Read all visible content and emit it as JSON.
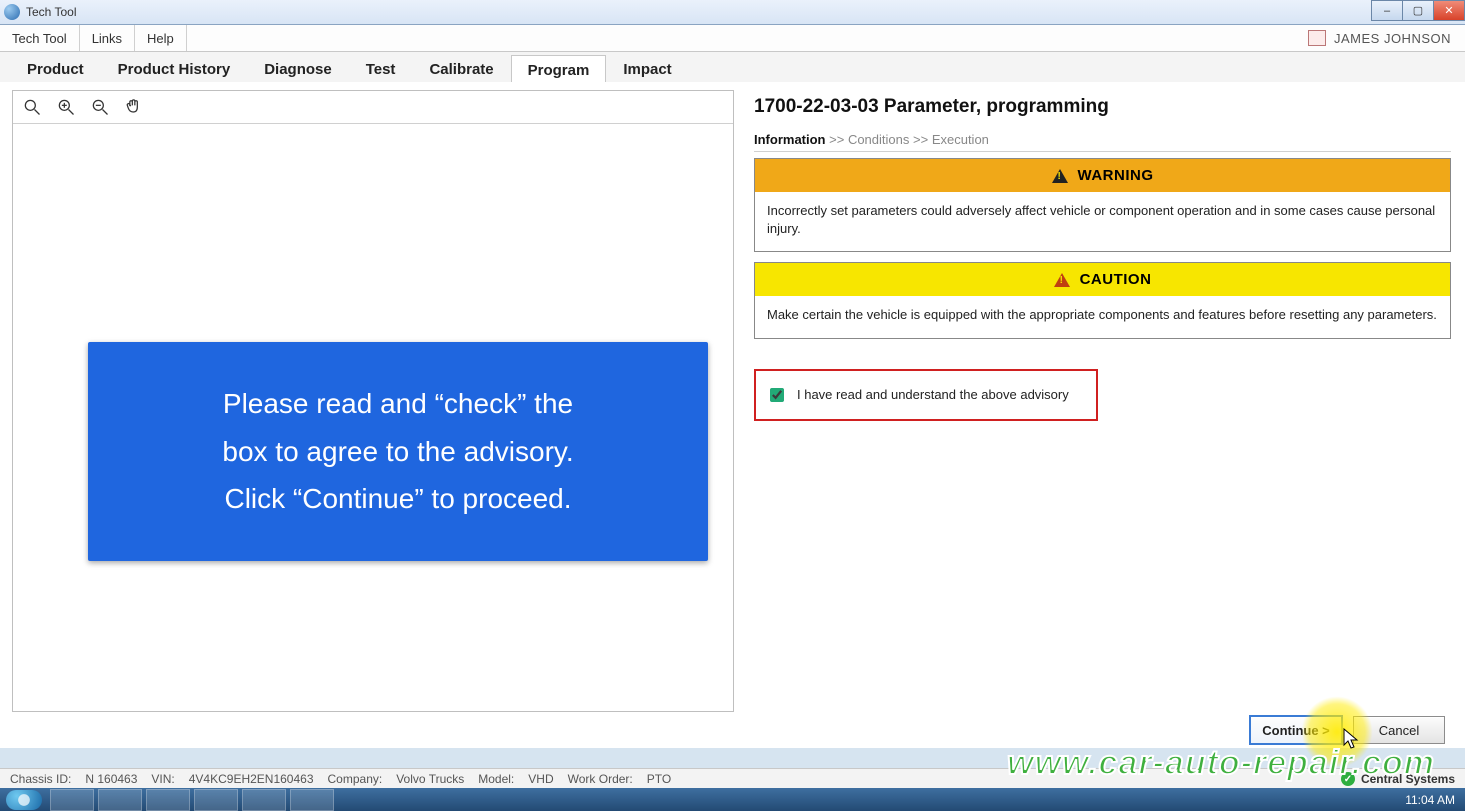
{
  "window": {
    "title": "Tech Tool"
  },
  "menubar": {
    "items": [
      "Tech Tool",
      "Links",
      "Help"
    ],
    "user": "JAMES JOHNSON"
  },
  "tabs": {
    "items": [
      "Product",
      "Product History",
      "Diagnose",
      "Test",
      "Calibrate",
      "Program",
      "Impact"
    ],
    "active_index": 5
  },
  "right": {
    "heading": "1700-22-03-03 Parameter, programming",
    "breadcrumb": {
      "active": "Information",
      "sep": ">>",
      "items": [
        "Conditions",
        "Execution"
      ]
    },
    "warning": {
      "title": "WARNING",
      "body": "Incorrectly set parameters could adversely affect vehicle or component operation and in some cases cause personal injury."
    },
    "caution": {
      "title": "CAUTION",
      "body": "Make certain the vehicle is equipped with the appropriate components and features before resetting any parameters."
    },
    "ack_label": "I have read and understand the above advisory",
    "continue_label": "Continue >",
    "cancel_label": "Cancel"
  },
  "overlay": {
    "line1": "Please read and “check” the",
    "line2": "box to agree to the advisory.",
    "line3": "Click “Continue” to proceed."
  },
  "status": {
    "chassis_label": "Chassis ID:",
    "chassis": "N 160463",
    "vin_label": "VIN:",
    "vin": "4V4KC9EH2EN160463",
    "company_label": "Company:",
    "company": "Volvo Trucks",
    "model_label": "Model:",
    "model": "VHD",
    "wo_label": "Work Order:",
    "wo": "PTO",
    "central": "Central Systems"
  },
  "taskbar": {
    "clock": "11:04 AM"
  },
  "watermark": "www.car-auto-repair.com"
}
